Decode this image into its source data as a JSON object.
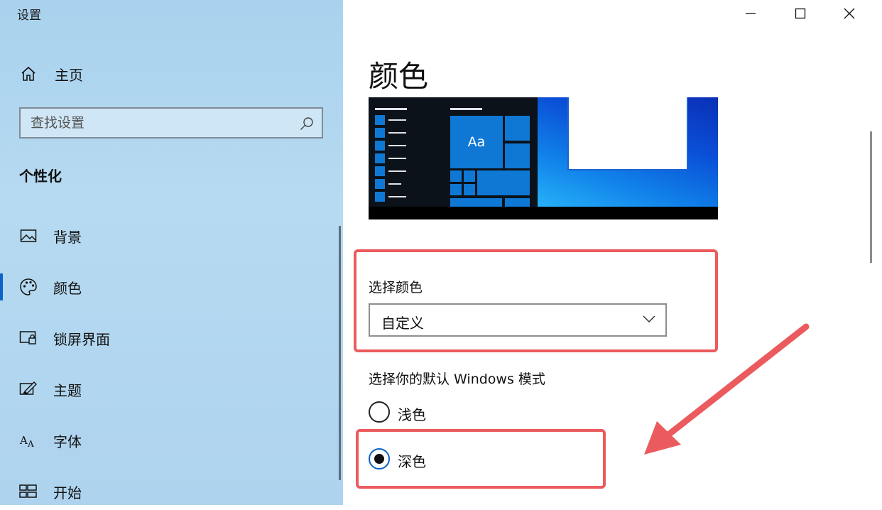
{
  "window": {
    "title": "设置"
  },
  "sidebar": {
    "home_label": "主页",
    "search_placeholder": "查找设置",
    "section_heading": "个性化",
    "items": [
      {
        "label": "背景",
        "icon": "image-icon"
      },
      {
        "label": "颜色",
        "icon": "palette-icon",
        "selected": true
      },
      {
        "label": "锁屏界面",
        "icon": "lock-screen-icon"
      },
      {
        "label": "主题",
        "icon": "theme-brush-icon"
      },
      {
        "label": "字体",
        "icon": "font-icon"
      },
      {
        "label": "开始",
        "icon": "start-icon"
      }
    ]
  },
  "content": {
    "page_title": "颜色",
    "preview": {
      "sample_text": "Aa"
    },
    "choose_color": {
      "label": "选择颜色",
      "selected": "自定义"
    },
    "windows_mode": {
      "label": "选择你的默认 Windows 模式",
      "options": [
        {
          "label": "浅色",
          "checked": false
        },
        {
          "label": "深色",
          "checked": true
        }
      ]
    }
  },
  "colors": {
    "accent": "#0a63c9",
    "annotation": "#eb5b5e",
    "sidebar_bg": "#b1d6f0",
    "tile_blue": "#0f78d4"
  }
}
